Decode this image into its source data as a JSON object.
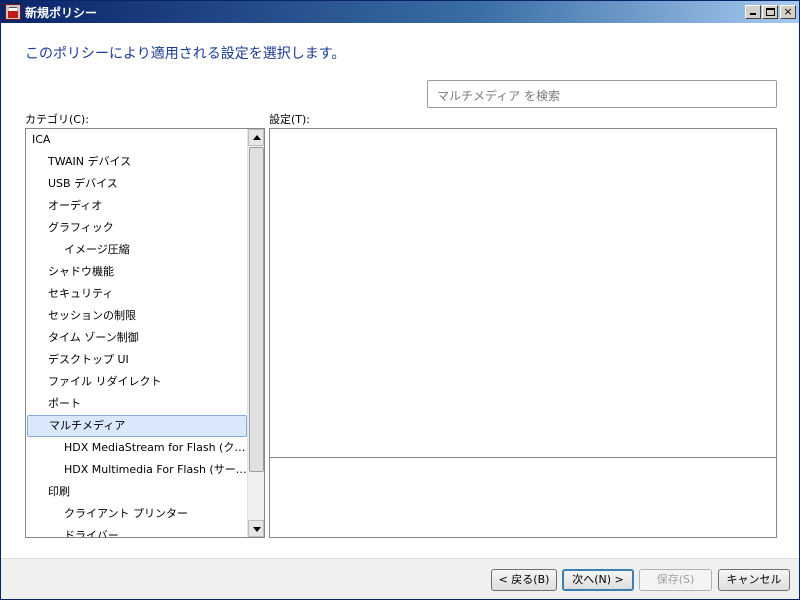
{
  "window": {
    "title": "新規ポリシー",
    "buttons": {
      "minimize": "_",
      "maximize": "□",
      "close": "×"
    }
  },
  "page": {
    "heading": "このポリシーにより適用される設定を選択します。"
  },
  "search": {
    "placeholder": "マルチメディア を検索"
  },
  "categories": {
    "label": "カテゴリ(C):",
    "items": [
      {
        "label": "ICA",
        "level": 0
      },
      {
        "label": "TWAIN デバイス",
        "level": 1
      },
      {
        "label": "USB デバイス",
        "level": 1
      },
      {
        "label": "オーディオ",
        "level": 1
      },
      {
        "label": "グラフィック",
        "level": 1
      },
      {
        "label": "イメージ圧縮",
        "level": 2
      },
      {
        "label": "シャドウ機能",
        "level": 1
      },
      {
        "label": "セキュリティ",
        "level": 1
      },
      {
        "label": "セッションの制限",
        "level": 1
      },
      {
        "label": "タイム ゾーン制御",
        "level": 1
      },
      {
        "label": "デスクトップ UI",
        "level": 1
      },
      {
        "label": "ファイル リダイレクト",
        "level": 1
      },
      {
        "label": "ポート",
        "level": 1
      },
      {
        "label": "マルチメディア",
        "level": 1,
        "selected": true
      },
      {
        "label": "HDX MediaStream for Flash (クライアント)",
        "level": 2
      },
      {
        "label": "HDX Multimedia For Flash (サーバー)",
        "level": 2
      },
      {
        "label": "印刷",
        "level": 1
      },
      {
        "label": "クライアント プリンター",
        "level": 2
      },
      {
        "label": "ドライバー",
        "level": 2
      }
    ]
  },
  "settings": {
    "label": "設定(T):"
  },
  "footer": {
    "back": "< 戻る(B)",
    "next": "次へ(N) >",
    "save": "保存(S)",
    "cancel": "キャンセル"
  },
  "colors": {
    "title_bar": "#0a246a",
    "heading_text": "#1a3c96",
    "selection_bg": "#d9e8fb",
    "selection_border": "#84acdd",
    "default_button_border": "#3c7fb1"
  }
}
